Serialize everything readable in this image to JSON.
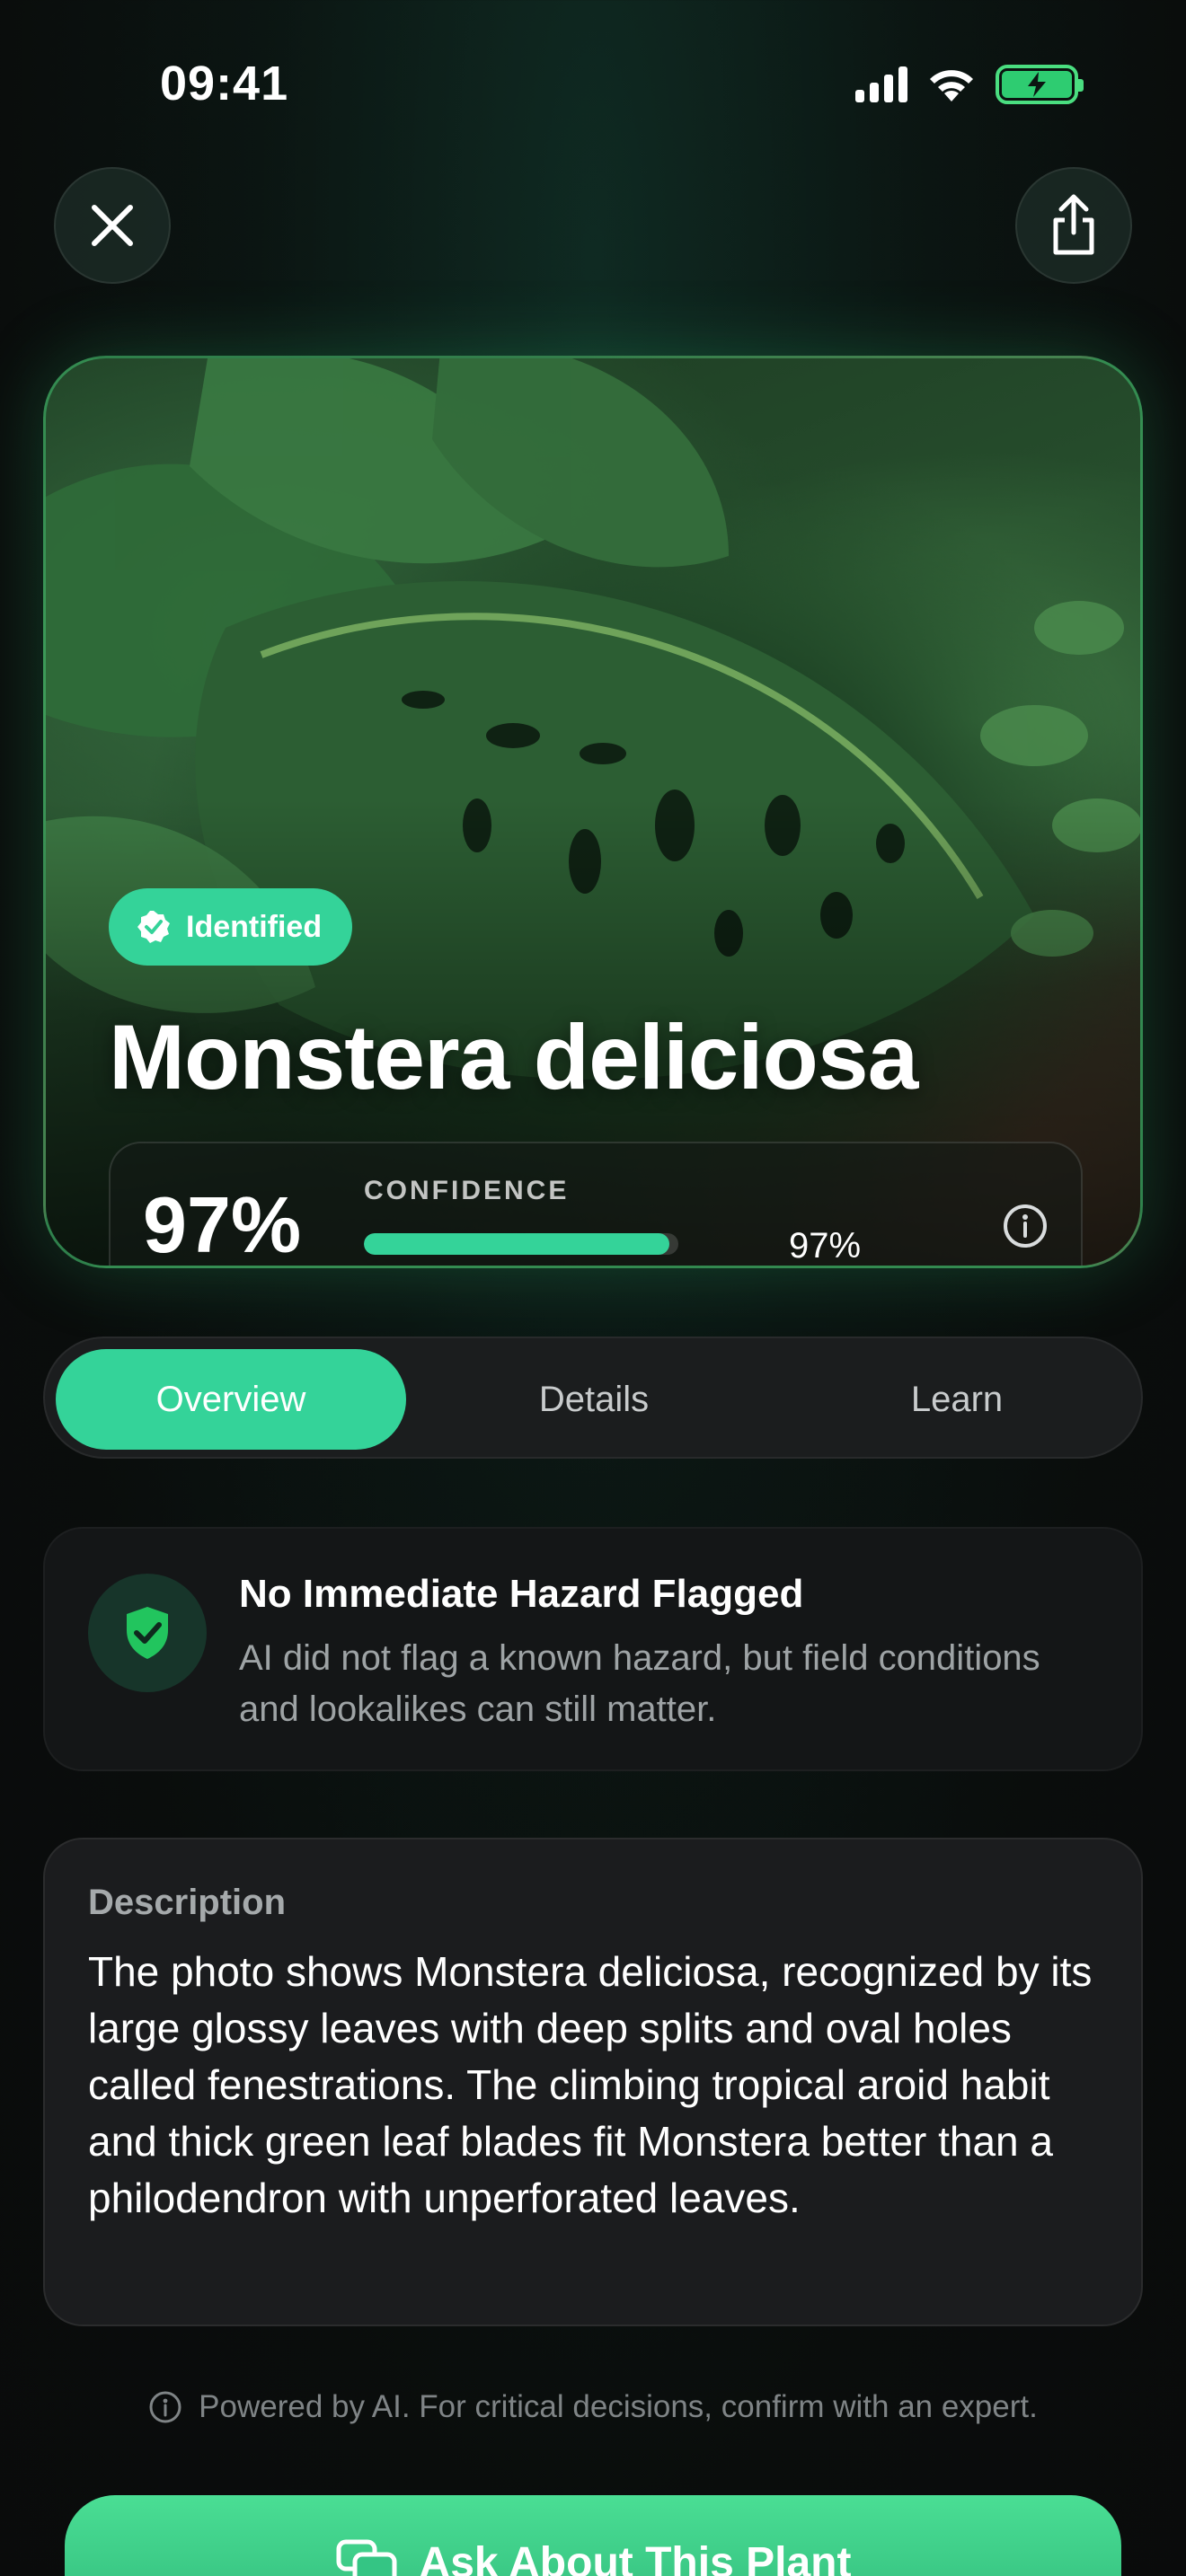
{
  "status_bar": {
    "time": "09:41"
  },
  "header": {
    "close_icon": "close-icon",
    "share_icon": "share-icon"
  },
  "result": {
    "badge_label": "Identified",
    "plant_name": "Monstera deliciosa",
    "confidence_percent": "97%",
    "confidence_label": "CONFIDENCE",
    "confidence_value": 0.97,
    "confidence_bar_text": "97%"
  },
  "tabs": [
    {
      "label": "Overview",
      "active": true
    },
    {
      "label": "Details",
      "active": false
    },
    {
      "label": "Learn",
      "active": false
    }
  ],
  "hazard": {
    "title": "No Immediate Hazard Flagged",
    "text": "AI did not flag a known hazard, but field conditions and lookalikes can still matter."
  },
  "description": {
    "label": "Description",
    "text": "The photo shows Monstera deliciosa, recognized by its large glossy leaves with deep splits and oval holes called fenestrations. The climbing tropical aroid habit and thick green leaf blades fit Monstera better than a philodendron with unperforated leaves."
  },
  "footnote": "Powered by AI. For critical decisions, confirm with an expert.",
  "cta_label": "Ask About This Plant",
  "colors": {
    "accent": "#34d399",
    "background": "#0a0d0c",
    "card": "#1b1c1e"
  }
}
